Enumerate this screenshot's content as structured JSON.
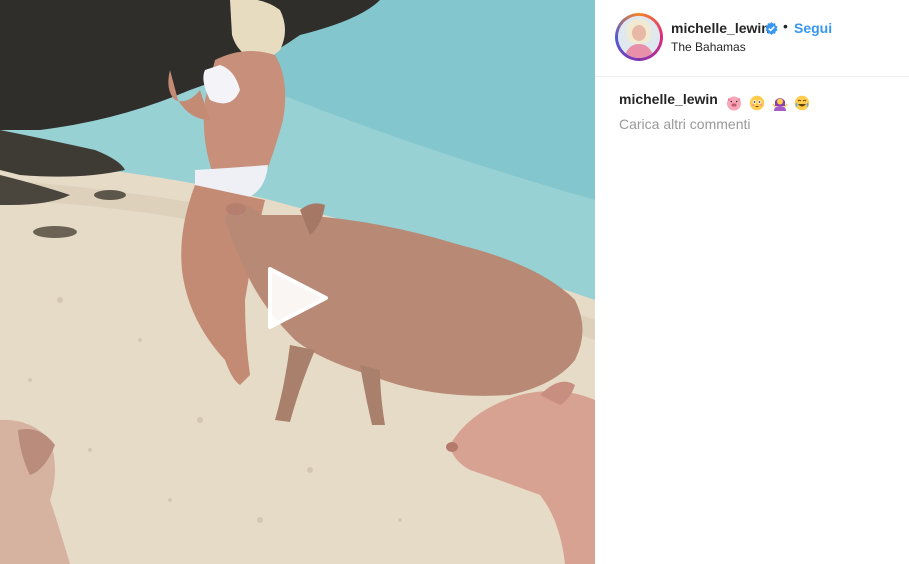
{
  "post": {
    "username": "michelle_lewin",
    "follow_label": "Segui",
    "separator": "•",
    "location": "The Bahamas"
  },
  "caption": {
    "username": "michelle_lewin",
    "emojis": [
      "pig-face",
      "flushed-face",
      "woman-shrugging",
      "joy-face"
    ]
  },
  "comments": {
    "load_more_label": "Carica altri commenti"
  },
  "colors": {
    "follow": "#3897f0",
    "verified": "#3897f0",
    "muted": "#999999"
  }
}
